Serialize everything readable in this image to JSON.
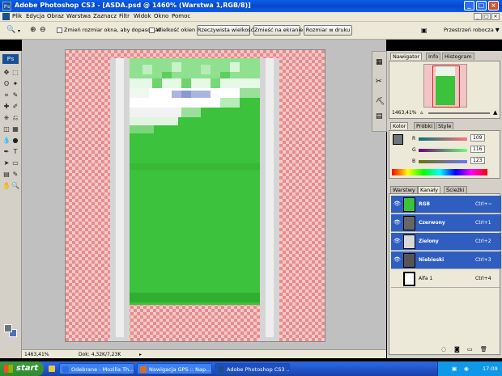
{
  "window": {
    "title": "Adobe Photoshop CS3 - [ASDA.psd @ 1460% (Warstwa 1,RGB/8)]",
    "app_badge": "Ps",
    "controls": [
      "_",
      "□",
      "×"
    ]
  },
  "menu": {
    "items": [
      "Plik",
      "Edycja",
      "Obraz",
      "Warstwa",
      "Zaznacz",
      "Filtr",
      "Widok",
      "Okno",
      "Pomoc"
    ]
  },
  "options": {
    "resize_windows_label": "Zmień rozmiar okna, aby dopasować",
    "ignore_palettes_label": "Wielkość okien",
    "actual_pixels_btn": "Rzeczywista wielkość",
    "fit_screen_btn": "Zmieść na ekranie",
    "print_size_btn": "Rozmiar w druku",
    "workspace_label": "Przestrzeń robocza ▼"
  },
  "toolbox": {
    "badge": "Ps",
    "tool_icons": [
      "move-icon",
      "marquee-icon",
      "lasso-icon",
      "magic-wand-icon",
      "crop-icon",
      "eyedropper-icon",
      "healing-icon",
      "brush-icon",
      "stamp-icon",
      "history-brush-icon",
      "eraser-icon",
      "gradient-icon",
      "blur-icon",
      "dodge-icon",
      "pen-icon",
      "type-icon",
      "path-select-icon",
      "shape-icon",
      "notes-icon",
      "eyedropper2-icon",
      "hand-icon",
      "zoom-icon"
    ],
    "glyphs": [
      "✥",
      "⬚",
      "ʘ",
      "✦",
      "⌗",
      "✎",
      "✚",
      "✐",
      "⎈",
      "⎌",
      "◫",
      "▦",
      "💧",
      "●",
      "✒",
      "T",
      "➤",
      "▭",
      "▤",
      "✎",
      "✋",
      "🔍"
    ],
    "foreground_color": "#6d7480",
    "background_color": "#4e6fb0"
  },
  "status": {
    "zoom": "1463,41%",
    "doc": "Dok: 4,32K/7,23K"
  },
  "navigator": {
    "tabs": [
      "Nawigator",
      "Info",
      "Histogram"
    ],
    "zoom": "1463,41%"
  },
  "color": {
    "tabs": [
      "Kolor",
      "Próbki",
      "Style"
    ],
    "channels": [
      {
        "label": "R",
        "value": "109"
      },
      {
        "label": "G",
        "value": "116"
      },
      {
        "label": "B",
        "value": "123"
      }
    ],
    "swatch": "#6d747b"
  },
  "channels_panel": {
    "tabs": [
      "Warstwy",
      "Kanały",
      "Ścieżki"
    ],
    "rows": [
      {
        "name": "RGB",
        "shortcut": "Ctrl+~",
        "selected": true
      },
      {
        "name": "Czerwony",
        "shortcut": "Ctrl+1",
        "selected": true
      },
      {
        "name": "Zielony",
        "shortcut": "Ctrl+2",
        "selected": true
      },
      {
        "name": "Niebieski",
        "shortcut": "Ctrl+3",
        "selected": true
      },
      {
        "name": "Alfa 1",
        "shortcut": "Ctrl+4",
        "selected": false
      }
    ]
  },
  "taskbar": {
    "start": "start",
    "tasks": [
      {
        "label": "Odebrane - Mozilla Th...",
        "color": "#2d6de0"
      },
      {
        "label": "Nawigacja GPS :: Nap...",
        "color": "#e06a1f"
      },
      {
        "label": "Adobe Photoshop CS3 ...",
        "color": "#1c4f8f"
      }
    ],
    "clock": "17:09"
  }
}
